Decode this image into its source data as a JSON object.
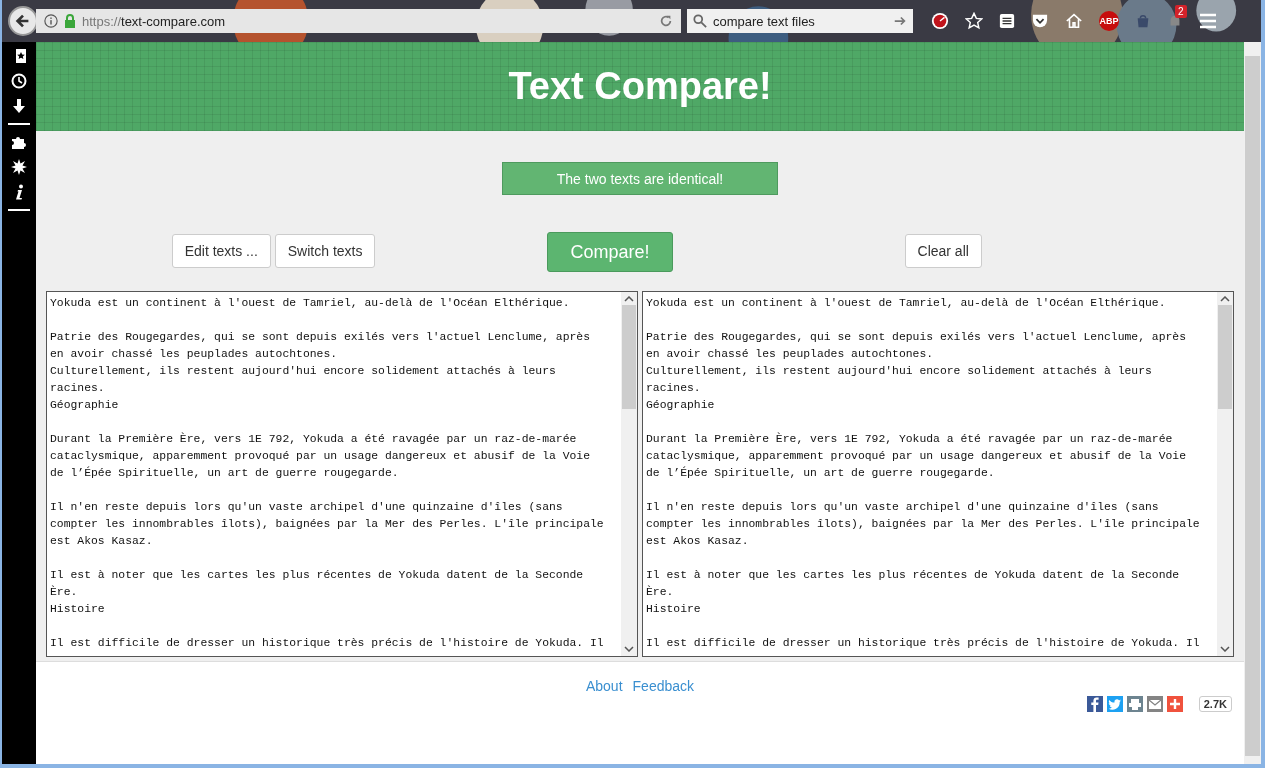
{
  "browser": {
    "url_scheme": "https://",
    "url_host": "text-compare.com",
    "search_value": "compare text files",
    "notification_count": "2",
    "adblock_label": "ABP"
  },
  "sidebar": {
    "items": [
      {
        "kind": "bookmarks"
      },
      {
        "kind": "history"
      },
      {
        "kind": "downloads"
      },
      {
        "kind": "divider"
      },
      {
        "kind": "addons"
      },
      {
        "kind": "burst"
      },
      {
        "kind": "info"
      },
      {
        "kind": "divider"
      }
    ]
  },
  "header": {
    "title": "Text Compare!"
  },
  "message": "The two texts are identical!",
  "buttons": {
    "edit": "Edit texts ...",
    "switch": "Switch texts",
    "compare": "Compare!",
    "clear": "Clear all"
  },
  "panes": [
    {
      "paragraphs": [
        [
          "Yokuda est un continent à l'ouest de Tamriel, au-delà de l'Océan Elthérique."
        ],
        [
          "Patrie des Rougegardes, qui se sont depuis exilés vers l'actuel Lenclume, après",
          "en avoir chassé les peuplades autochtones.",
          "Culturellement, ils restent aujourd'hui encore solidement attachés à leurs",
          "racines.",
          "Géographie"
        ],
        [
          "Durant la Première Ère, vers 1E 792, Yokuda a été ravagée par un raz-de-marée",
          "cataclysmique, apparemment provoqué par un usage dangereux et abusif de la Voie",
          "de l’Épée Spirituelle, un art de guerre rougegarde."
        ],
        [
          "Il n'en reste depuis lors qu'un vaste archipel d'une quinzaine d'îles (sans",
          "compter les innombrables îlots), baignées par la Mer des Perles. L'île principale",
          "est Akos Kasaz."
        ],
        [
          "Il est à noter que les cartes les plus récentes de Yokuda datent de la Seconde",
          "Ère.",
          "Histoire"
        ],
        [
          "Il est difficile de dresser un historique très précis de l'histoire de Yokuda. Il"
        ]
      ]
    },
    {
      "paragraphs": [
        [
          "Yokuda est un continent à l'ouest de Tamriel, au-delà de l'Océan Elthérique."
        ],
        [
          "Patrie des Rougegardes, qui se sont depuis exilés vers l'actuel Lenclume, après",
          "en avoir chassé les peuplades autochtones.",
          "Culturellement, ils restent aujourd'hui encore solidement attachés à leurs",
          "racines.",
          "Géographie"
        ],
        [
          "Durant la Première Ère, vers 1E 792, Yokuda a été ravagée par un raz-de-marée",
          "cataclysmique, apparemment provoqué par un usage dangereux et abusif de la Voie",
          "de l’Épée Spirituelle, un art de guerre rougegarde."
        ],
        [
          "Il n'en reste depuis lors qu'un vaste archipel d'une quinzaine d'îles (sans",
          "compter les innombrables îlots), baignées par la Mer des Perles. L'île principale",
          "est Akos Kasaz."
        ],
        [
          "Il est à noter que les cartes les plus récentes de Yokuda datent de la Seconde",
          "Ère.",
          "Histoire"
        ],
        [
          "Il est difficile de dresser un historique très précis de l'histoire de Yokuda. Il"
        ]
      ]
    }
  ],
  "footer": {
    "links": [
      "About",
      "Feedback"
    ],
    "share": [
      {
        "kind": "facebook",
        "color": "#3b5998"
      },
      {
        "kind": "twitter",
        "color": "#1da1f2"
      },
      {
        "kind": "print",
        "color": "#6d8490"
      },
      {
        "kind": "email",
        "color": "#848484"
      },
      {
        "kind": "more",
        "color": "#f0523d"
      }
    ],
    "share_count": "2.7K"
  }
}
